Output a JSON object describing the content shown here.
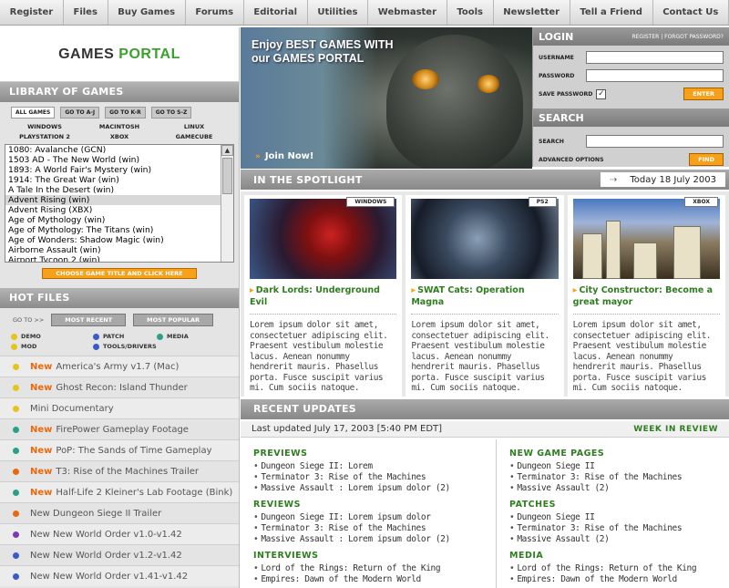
{
  "nav": [
    "Register",
    "Files",
    "Buy Games",
    "Forums",
    "Editorial",
    "Utilities",
    "Webmaster",
    "Tools",
    "Newsletter",
    "Tell a Friend",
    "Contact Us"
  ],
  "logo": {
    "part1": "GAMES",
    "part2": "PORTAL"
  },
  "library": {
    "title": "LIBRARY OF GAMES",
    "filters": [
      "ALL GAMES",
      "GO TO A-J",
      "GO TO K-R",
      "GO TO S-Z"
    ],
    "platforms": [
      "WINDOWS",
      "MACINTOSH",
      "LINUX",
      "PLAYSTATION 2",
      "XBOX",
      "GAMECUBE"
    ],
    "games": [
      "1080: Avalanche (GCN)",
      "1503 AD - The New World (win)",
      "1893: A World Fair's Mystery (win)",
      "1914: The Great War (win)",
      "A Tale In the Desert (win)",
      "Advent Rising (win)",
      "Advent Rising (XBX)",
      "Age of Mythology (win)",
      "Age of Mythology: The Titans (win)",
      "Age of Wonders: Shadow Magic (win)",
      "Airborne Assault (win)",
      "Airport Tycoon 2 (win)"
    ],
    "selected_index": 5,
    "choose_button": "CHOOSE GAME TITLE AND CLICK HERE"
  },
  "hot": {
    "title": "HOT FILES",
    "goto": "GO TO >>",
    "most_recent": "MOST RECENT",
    "most_popular": "MOST POPULAR",
    "legend": [
      {
        "label": "DEMO",
        "color": "#e3c51b"
      },
      {
        "label": "PATCH",
        "color": "#3a5ac8"
      },
      {
        "label": "MEDIA",
        "color": "#2aa08a"
      },
      {
        "label": "MOD",
        "color": "#e3c51b"
      },
      {
        "label": "TOOLS/DRIVERS",
        "color": "#3a5ac8"
      }
    ],
    "new_label": "New",
    "items": [
      {
        "new": true,
        "text": "America's Army v1.7 (Mac)",
        "color": "#e3c51b"
      },
      {
        "new": true,
        "text": "Ghost Recon: Island Thunder",
        "color": "#e3c51b"
      },
      {
        "new": false,
        "text": "Mini Documentary",
        "color": "#e3c51b"
      },
      {
        "new": true,
        "text": "FirePower Gameplay Footage",
        "color": "#2aa08a"
      },
      {
        "new": true,
        "text": "PoP: The Sands of Time Gameplay",
        "color": "#2aa08a"
      },
      {
        "new": true,
        "text": "T3: Rise of the Machines Trailer",
        "color": "#e86a0c"
      },
      {
        "new": true,
        "text": "Half-Life 2 Kleiner's Lab Footage (Bink)",
        "color": "#2aa08a"
      },
      {
        "new": false,
        "text": "New Dungeon Siege II Trailer",
        "color": "#e86a0c"
      },
      {
        "new": false,
        "text": "New New World Order v1.0-v1.42",
        "color": "#7a3ab8"
      },
      {
        "new": false,
        "text": "New New World Order v1.2-v1.42",
        "color": "#3a5ac8"
      },
      {
        "new": false,
        "text": "New New World Order v1.41-v1.42",
        "color": "#3a5ac8"
      }
    ]
  },
  "hero": {
    "title": "Enjoy BEST GAMES WITH our GAMES PORTAL",
    "join": "Join Now!"
  },
  "login": {
    "title": "LOGIN",
    "links": "REGISTER | FORGOT PASSWORD?",
    "username": "USERNAME",
    "password": "PASSWORD",
    "save": "SAVE PASSWORD",
    "enter": "ENTER",
    "search_title": "SEARCH",
    "search": "SEARCH",
    "advanced": "ADVANCED OPTIONS",
    "find": "FIND"
  },
  "spotlight": {
    "title": "IN THE SPOTLIGHT",
    "date": "Today 18 July 2003",
    "items": [
      {
        "tag": "WINDOWS",
        "title": "Dark Lords: Underground Evil",
        "desc": "Lorem ipsum dolor sit amet, consectetuer adipiscing elit. Praesent vestibulum molestie lacus. Aenean nonummy hendrerit mauris. Phasellus porta. Fusce suscipit varius mi. Cum sociis natoque."
      },
      {
        "tag": "PS2",
        "title": "SWAT Cats: Operation Magna",
        "desc": "Lorem ipsum dolor sit amet, consectetuer adipiscing elit. Praesent vestibulum molestie lacus. Aenean nonummy hendrerit mauris. Phasellus porta. Fusce suscipit varius mi. Cum sociis natoque."
      },
      {
        "tag": "XBOX",
        "title": "City Constructor: Become a great mayor",
        "desc": "Lorem ipsum dolor sit amet, consectetuer adipiscing elit. Praesent vestibulum molestie lacus. Aenean nonummy hendrerit mauris. Phasellus porta. Fusce suscipit varius mi. Cum sociis natoque."
      }
    ]
  },
  "updates": {
    "title": "RECENT UPDATES",
    "last": "Last updated July 17, 2003 [5:40 PM EDT]",
    "week": "WEEK IN REVIEW",
    "left": [
      {
        "h": "PREVIEWS",
        "items": [
          "Dungeon Siege II: Lorem",
          "Terminator 3: Rise of the Machines",
          "Massive Assault : Lorem ipsum dolor (2)"
        ]
      },
      {
        "h": "REVIEWS",
        "items": [
          "Dungeon Siege II: Lorem ipsum dolor",
          "Terminator 3: Rise of the Machines",
          "Massive Assault : Lorem ipsum dolor (2)"
        ]
      },
      {
        "h": "INTERVIEWS",
        "items": [
          "Lord of the Rings: Return of the King",
          "Empires: Dawn of the Modern World"
        ]
      }
    ],
    "right": [
      {
        "h": "NEW GAME PAGES",
        "items": [
          "Dungeon Siege II",
          "Terminator 3: Rise of the Machines",
          "Massive Assault (2)"
        ]
      },
      {
        "h": "PATCHES",
        "items": [
          "Dungeon Siege II",
          "Terminator 3: Rise of the Machines",
          "Massive Assault (2)"
        ]
      },
      {
        "h": "MEDIA",
        "items": [
          "Lord of the Rings: Return of the King",
          "Empires: Dawn of the Modern World"
        ]
      }
    ]
  }
}
